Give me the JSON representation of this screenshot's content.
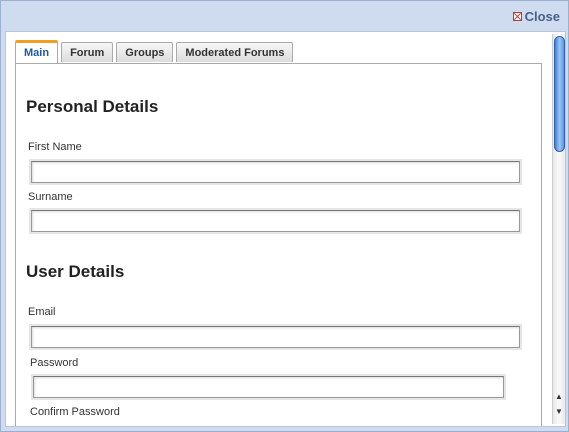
{
  "dialog": {
    "close_label": "Close"
  },
  "tabs": [
    {
      "label": "Main",
      "active": true
    },
    {
      "label": "Forum",
      "active": false
    },
    {
      "label": "Groups",
      "active": false
    },
    {
      "label": "Moderated Forums",
      "active": false
    }
  ],
  "sections": {
    "personal": {
      "title": "Personal Details",
      "first_name_label": "First Name",
      "first_name_value": "",
      "surname_label": "Surname",
      "surname_value": ""
    },
    "user": {
      "title": "User Details",
      "email_label": "Email",
      "email_value": "",
      "password_label": "Password",
      "password_value": "",
      "confirm_password_label": "Confirm Password"
    }
  },
  "scrollbar": {
    "up_icon": "triangle-up",
    "down_icon": "triangle-down"
  },
  "colors": {
    "accent": "#1a5ba8",
    "tab_highlight": "#f0a020",
    "close": "#c0392b"
  }
}
